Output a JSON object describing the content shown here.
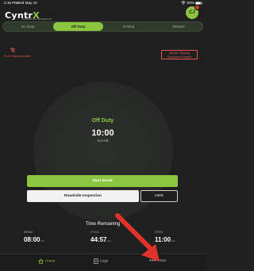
{
  "status_bar": {
    "time": "2:15 PM",
    "date": "Wed May 10",
    "battery": "84%"
  },
  "header": {
    "brand_prefix": "Cyntr",
    "brand_x": "X",
    "tagline": "CONNECTED TECHNOLOGY",
    "avatar_initials": "CJ"
  },
  "tabs": [
    {
      "label": "On Duty"
    },
    {
      "label": "Off Duty"
    },
    {
      "label": "Driving"
    },
    {
      "label": "Sleeper"
    }
  ],
  "alerts": {
    "eld_status": "ELD Disconnected",
    "update_line1": "Update Shipping",
    "update_line2": "Document Number"
  },
  "dial": {
    "status": "Off Duty",
    "hours": "10:00",
    "caption": "hrs left"
  },
  "actions": {
    "start_break": "Start Break",
    "roadside": "Roadside Inspection",
    "hos": "HOS"
  },
  "time_remaining": {
    "title": "Time Remaining",
    "items": [
      {
        "label": "BREAK",
        "value": "08:00",
        "unit": "hrs"
      },
      {
        "label": "CYCLE",
        "value": "44:57",
        "unit": "hrs"
      },
      {
        "label": "DRIVE",
        "value": "11:00",
        "unit": "hrs"
      }
    ]
  },
  "nav": {
    "home": "Home",
    "logs": "Logs",
    "more": "More"
  },
  "colors": {
    "accent": "#8cc641",
    "alert": "#e8584f",
    "background": "#1f1f1f",
    "annotation_arrow": "#e0312b"
  }
}
